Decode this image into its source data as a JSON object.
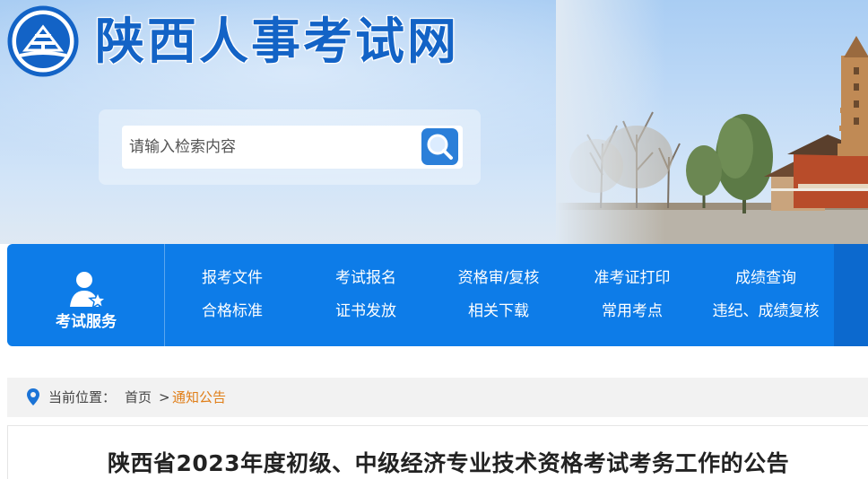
{
  "header": {
    "site_title": "陕西人事考试网",
    "search_placeholder": "请输入检索内容"
  },
  "nav": {
    "service_label": "考试服务",
    "links": [
      {
        "label": "报考文件"
      },
      {
        "label": "考试报名"
      },
      {
        "label": "资格审/复核"
      },
      {
        "label": "准考证打印"
      },
      {
        "label": "成绩查询"
      },
      {
        "label": "合格标准"
      },
      {
        "label": "证书发放"
      },
      {
        "label": "相关下载"
      },
      {
        "label": "常用考点"
      },
      {
        "label": "违纪、成绩复核"
      }
    ]
  },
  "breadcrumb": {
    "prefix": "当前位置：",
    "home": "首页",
    "separator": ">",
    "current": "通知公告"
  },
  "article": {
    "title": "陕西省2023年度初级、中级经济专业技术资格考试考务工作的公告"
  },
  "colors": {
    "brand_blue": "#1363c6",
    "nav_blue": "#0d7ce8",
    "breadcrumb_current": "#e07e18"
  }
}
